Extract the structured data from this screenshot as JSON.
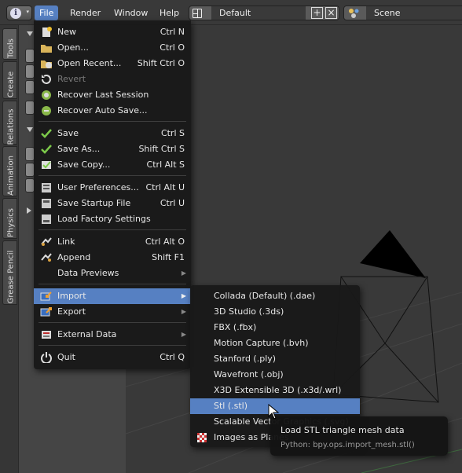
{
  "header": {
    "menus": [
      "File",
      "Render",
      "Window",
      "Help"
    ],
    "layout_name": "Default",
    "scene_name": "Scene"
  },
  "tabs": [
    "Tools",
    "Create",
    "Relations",
    "Animation",
    "Physics",
    "Grease Pencil"
  ],
  "file_menu": {
    "items": [
      {
        "label": "New",
        "shortcut": "Ctrl N",
        "icon": "new-file-icon"
      },
      {
        "label": "Open...",
        "shortcut": "Ctrl O",
        "icon": "folder-open-icon"
      },
      {
        "label": "Open Recent...",
        "shortcut": "Shift Ctrl O",
        "icon": "open-recent-icon"
      },
      {
        "label": "Revert",
        "shortcut": "",
        "icon": "revert-icon",
        "disabled": true
      },
      {
        "label": "Recover Last Session",
        "shortcut": "",
        "icon": "recover-icon"
      },
      {
        "label": "Recover Auto Save...",
        "shortcut": "",
        "icon": "recover-auto-icon"
      },
      {
        "label": "Save",
        "shortcut": "Ctrl S",
        "icon": "checkmark-icon"
      },
      {
        "label": "Save As...",
        "shortcut": "Shift Ctrl S",
        "icon": "checkmark-icon"
      },
      {
        "label": "Save Copy...",
        "shortcut": "Ctrl Alt S",
        "icon": "save-copy-icon"
      },
      {
        "label": "User Preferences...",
        "shortcut": "Ctrl Alt U",
        "icon": "preferences-icon"
      },
      {
        "label": "Save Startup File",
        "shortcut": "Ctrl U",
        "icon": "save-startup-icon"
      },
      {
        "label": "Load Factory Settings",
        "shortcut": "",
        "icon": "factory-icon"
      },
      {
        "label": "Link",
        "shortcut": "Ctrl Alt O",
        "icon": "link-icon"
      },
      {
        "label": "Append",
        "shortcut": "Shift F1",
        "icon": "append-icon"
      },
      {
        "label": "Data Previews",
        "shortcut": "",
        "icon": ""
      },
      {
        "label": "Import",
        "shortcut": "",
        "icon": "import-icon"
      },
      {
        "label": "Export",
        "shortcut": "",
        "icon": "export-icon"
      },
      {
        "label": "External Data",
        "shortcut": "",
        "icon": "external-data-icon"
      },
      {
        "label": "Quit",
        "shortcut": "Ctrl Q",
        "icon": "power-icon"
      }
    ]
  },
  "import_menu": {
    "items": [
      "Collada (Default) (.dae)",
      "3D Studio (.3ds)",
      "FBX (.fbx)",
      "Motion Capture (.bvh)",
      "Stanford (.ply)",
      "Wavefront (.obj)",
      "X3D Extensible 3D (.x3d/.wrl)",
      "Stl (.stl)",
      "Scalable Vector Graphics (.svg)",
      "Images as Planes"
    ]
  },
  "tooltip": {
    "title": "Load STL triangle mesh data",
    "python": "Python: bpy.ops.import_mesh.stl()"
  },
  "colors": {
    "highlight": "#5680c2",
    "menu_bg": "#191919",
    "viewport": "#393939"
  }
}
